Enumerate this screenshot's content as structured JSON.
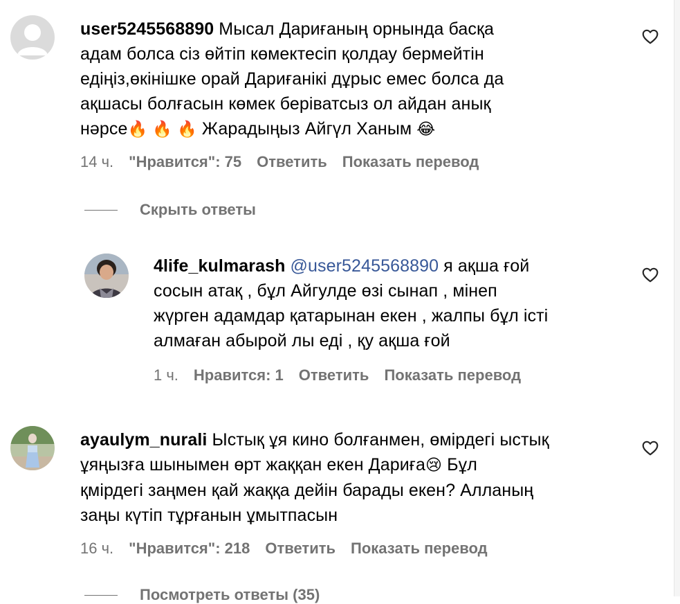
{
  "comments": [
    {
      "username": "user5245568890",
      "text_lines": [
        "Мысал Дариғаның орнында басқа",
        "адам болса сіз өйтіп көмектесіп қолдау бермейтін",
        "едіңіз,өкінішке орай Дариғанікі дұрыс емес болса да",
        "ақшасы болғасын көмек беріватсыз ол айдан анық"
      ],
      "last_line_start": "нәрсе",
      "fire": "🔥",
      "last_line_text": "Жарадыңыз Айгүл Ханым",
      "laugh": "😂",
      "time": "14 ч.",
      "likes": "\"Нравится\": 75",
      "reply": "Ответить",
      "translate": "Показать перевод"
    },
    {
      "username": "4life_kulmarash",
      "mention": "@user5245568890",
      "first_line_rest": "я ақша ғой",
      "text_lines": [
        "сосын атақ , бұл Айгулде өзі сынап , мінеп",
        "жүрген адамдар қатарынан екен , жалпы бұл істі",
        "алмаған абырой лы еді , қу ақша ғой"
      ],
      "time": "1 ч.",
      "likes": "Нравится: 1",
      "reply": "Ответить",
      "translate": "Показать перевод"
    },
    {
      "username": "ayaulym_nurali",
      "first_line_rest": "Ыстық ұя кино болғанмен, өмірдегі ыстық",
      "line2_start": "ұяңызға шынымен өрт жаққан екен Дариға",
      "cry": "😢",
      "line2_end": "Бұл",
      "text_lines": [
        "қмірдегі заңмен қай жаққа дейін барады екен? Алланың",
        "заңы күтіп тұрғанын ұмытпасын"
      ],
      "time": "16 ч.",
      "likes": "\"Нравится\": 218",
      "reply": "Ответить",
      "translate": "Показать перевод"
    }
  ],
  "hide_replies": "Скрыть ответы",
  "view_replies": "Посмотреть ответы (35)",
  "colors": {
    "meta": "#737373",
    "mention": "#385898"
  }
}
